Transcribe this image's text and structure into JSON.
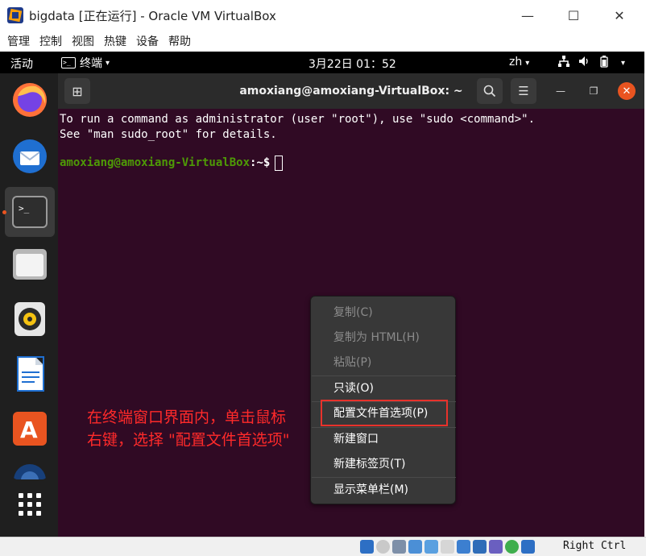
{
  "window": {
    "title": "bigdata [正在运行] - Oracle VM VirtualBox",
    "minimize": "—",
    "maximize": "☐",
    "close": "✕"
  },
  "vb_menu": [
    "管理",
    "控制",
    "视图",
    "热键",
    "设备",
    "帮助"
  ],
  "topbar": {
    "activities": "活动",
    "app_label": "终端",
    "app_glyph": ">_",
    "caret": "▾",
    "datetime": "3月22日  01：52",
    "lang": "zh",
    "network_icon": "network-icon",
    "volume_icon": "volume-icon",
    "battery_icon": "battery-icon"
  },
  "dock": {
    "icons": [
      "firefox-icon",
      "thunderbird-icon",
      "terminal-icon",
      "files-icon",
      "rhythmbox-icon",
      "writer-icon",
      "software-center-icon",
      "help-icon",
      "show-apps-icon"
    ]
  },
  "terminal": {
    "title": "amoxiang@amoxiang-VirtualBox: ~",
    "new_tab": "⊞",
    "search": "⌕",
    "menu": "☰",
    "min": "—",
    "max": "❐",
    "close": "✕",
    "lines": [
      "To run a command as administrator (user \"root\"), use \"sudo <command>\".",
      "See \"man sudo_root\" for details."
    ],
    "prompt_user": "amoxiang@amoxiang-VirtualBox",
    "prompt_path": ":~$"
  },
  "context_menu": {
    "items": [
      {
        "label": "复制(C)",
        "enabled": false
      },
      {
        "label": "复制为 HTML(H)",
        "enabled": false
      },
      {
        "label": "粘贴(P)",
        "enabled": false
      },
      {
        "label": "只读(O)",
        "enabled": true
      },
      {
        "label": "配置文件首选项(P)",
        "enabled": true,
        "highlighted": true
      },
      {
        "label": "新建窗口",
        "enabled": true
      },
      {
        "label": "新建标签页(T)",
        "enabled": true
      },
      {
        "label": "显示菜单栏(M)",
        "enabled": true
      }
    ]
  },
  "annotation": {
    "line1": "在终端窗口界面内，单击鼠标",
    "line2": "右键，选择 \"配置文件首选项\""
  },
  "statusbar": {
    "host_key": "Right Ctrl"
  },
  "colors": {
    "terminal_bg": "#300a24",
    "prompt_user": "#4e9a06",
    "annotation": "#ff2a2a",
    "ubuntu_orange": "#e95420"
  }
}
